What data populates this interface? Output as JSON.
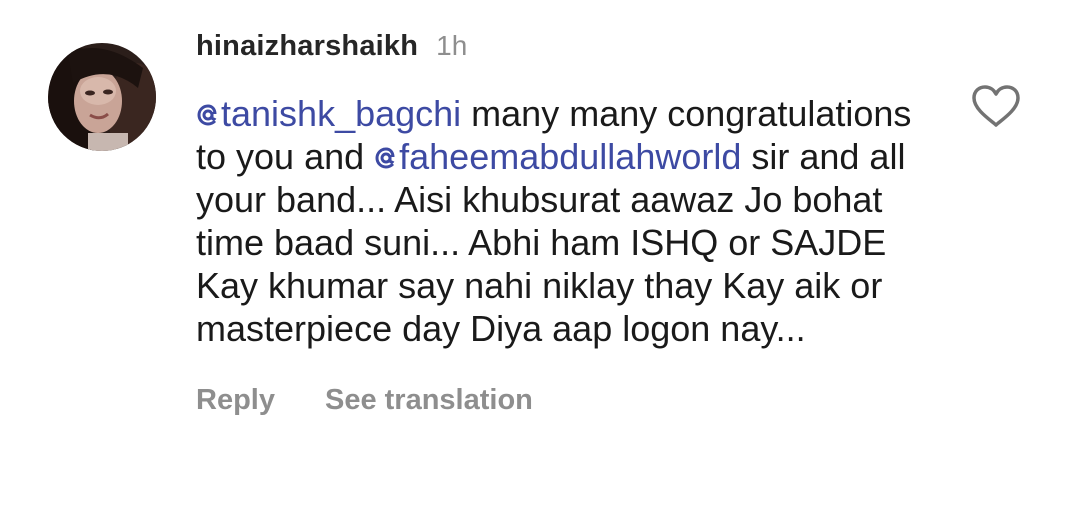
{
  "comment": {
    "username": "hinaizharshaikh",
    "time": "1h",
    "mention1": "tanishk_bagchi",
    "text1": " many many congratulations to you and ",
    "mention2": "faheemabdullahworld",
    "text2": " sir and all your band... Aisi khubsurat aawaz Jo bohat time baad suni... Abhi ham ISHQ or SAJDE Kay khumar say nahi niklay thay Kay aik or masterpiece day Diya aap logon nay...",
    "reply_label": "Reply",
    "translate_label": "See translation"
  },
  "icons": {
    "like": "heart-outline-icon",
    "mention": "threads-at-icon"
  },
  "colors": {
    "mention": "#3d4aa3",
    "muted": "#8e8e8e",
    "text": "#1a1a1a"
  }
}
